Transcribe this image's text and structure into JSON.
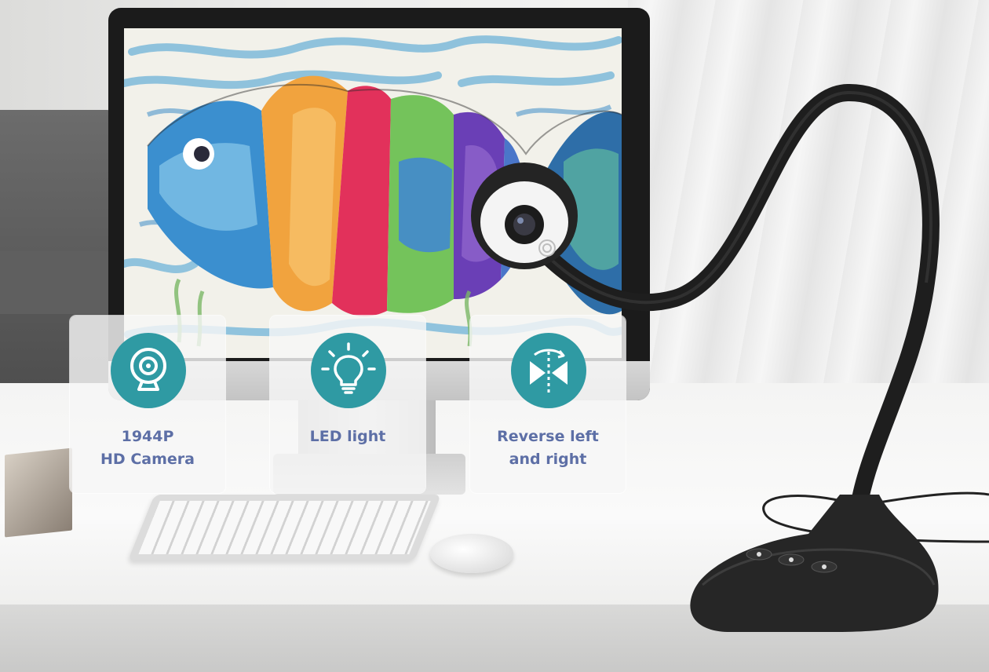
{
  "features": [
    {
      "icon": "webcam-icon",
      "label": "1944P\nHD Camera"
    },
    {
      "icon": "lightbulb-icon",
      "label": "LED light"
    },
    {
      "icon": "mirror-flip-icon",
      "label": "Reverse left\nand right"
    }
  ],
  "colors": {
    "icon_circle": "#2f9aa3",
    "label_text": "#5d6fa6",
    "camera_body": "#2a2a2a"
  }
}
